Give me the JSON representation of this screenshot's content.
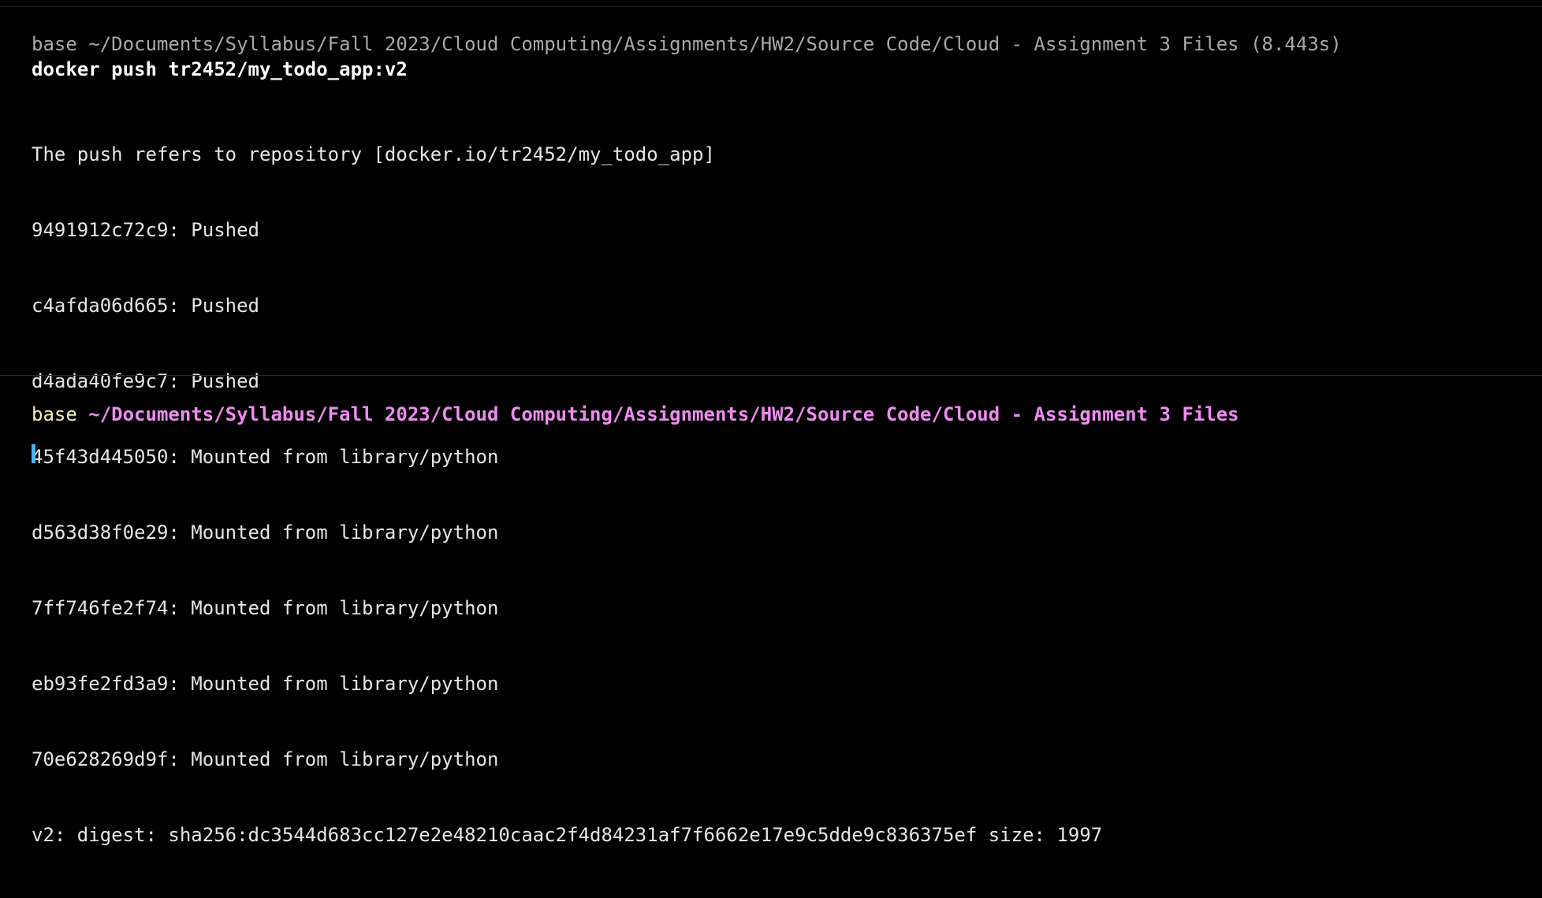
{
  "colors": {
    "background": "#000000",
    "env": "#f4f1b8",
    "path": "#ef8cf2",
    "cursor": "#4fb2ef",
    "meta": "#a8a8a8"
  },
  "previous_block": {
    "env": "base",
    "path": "~/Documents/Syllabus/Fall 2023/Cloud Computing/Assignments/HW2/Source Code/Cloud - Assignment 3 Files",
    "duration": "(8.443s)",
    "command": "docker push tr2452/my_todo_app:v2",
    "output": [
      "The push refers to repository [docker.io/tr2452/my_todo_app]",
      "9491912c72c9: Pushed",
      "c4afda06d665: Pushed",
      "d4ada40fe9c7: Pushed",
      "45f43d445050: Mounted from library/python",
      "d563d38f0e29: Mounted from library/python",
      "7ff746fe2f74: Mounted from library/python",
      "eb93fe2fd3a9: Mounted from library/python",
      "70e628269d9f: Mounted from library/python",
      "v2: digest: sha256:dc3544d683cc127e2e48210caac2f4d84231af7f6662e17e9c5dde9c836375ef size: 1997"
    ]
  },
  "current_prompt": {
    "env": "base",
    "path": "~/Documents/Syllabus/Fall 2023/Cloud Computing/Assignments/HW2/Source Code/Cloud - Assignment 3 Files"
  }
}
